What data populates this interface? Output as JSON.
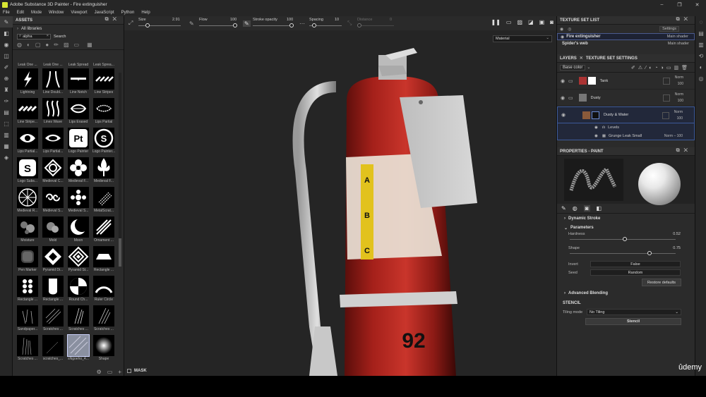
{
  "window": {
    "title": "Adobe Substance 3D Painter - Fire extinguisher",
    "min": "–",
    "max": "❐",
    "close": "✕"
  },
  "menu": [
    "File",
    "Edit",
    "Mode",
    "Window",
    "Viewport",
    "JavaScript",
    "Python",
    "Help"
  ],
  "assets": {
    "title": "ASSETS",
    "library": "All libraries",
    "search_value": "alpha",
    "search_button": "Search",
    "top_labels": [
      "Leak One ...",
      "Leak One ...",
      "Leak Spread",
      "Leak Sprea..."
    ],
    "tiles": [
      {
        "label": "Lightning",
        "icon": "lightning"
      },
      {
        "label": "Line Doubl...",
        "icon": "line-double"
      },
      {
        "label": "Line Notch",
        "icon": "line-notch"
      },
      {
        "label": "Line Stripes",
        "icon": "stripes"
      },
      {
        "label": "Line Stripe...",
        "icon": "stripes2"
      },
      {
        "label": "Lines Wave",
        "icon": "wave"
      },
      {
        "label": "Lips Erased",
        "icon": "lips"
      },
      {
        "label": "Lips Partial",
        "icon": "lips2"
      },
      {
        "label": "Lips Partial...",
        "icon": "eye"
      },
      {
        "label": "Lips Partial...",
        "icon": "eye2"
      },
      {
        "label": "Logo Painter",
        "icon": "pt"
      },
      {
        "label": "Logo Painter...",
        "icon": "s-logo"
      },
      {
        "label": "Logo Subs...",
        "icon": "s-square"
      },
      {
        "label": "Medieval C...",
        "icon": "knot"
      },
      {
        "label": "Medieval F...",
        "icon": "flower"
      },
      {
        "label": "Medieval F...",
        "icon": "fleur"
      },
      {
        "label": "Medieval R...",
        "icon": "rose"
      },
      {
        "label": "Medieval S...",
        "icon": "spiral"
      },
      {
        "label": "Medieval S...",
        "icon": "cross"
      },
      {
        "label": "MetalScrat...",
        "icon": "scratch"
      },
      {
        "label": "Moisture",
        "icon": "moisture"
      },
      {
        "label": "Mold",
        "icon": "mold"
      },
      {
        "label": "Moon",
        "icon": "moon"
      },
      {
        "label": "Ornament ...",
        "icon": "ornament"
      },
      {
        "label": "Pen Marker",
        "icon": "marker"
      },
      {
        "label": "Pyramid Di...",
        "icon": "pyramid"
      },
      {
        "label": "Pyramid St...",
        "icon": "pyramid2"
      },
      {
        "label": "Rectangle ...",
        "icon": "trap"
      },
      {
        "label": "Rectangle ...",
        "icon": "dots"
      },
      {
        "label": "Rectangle ...",
        "icon": "round"
      },
      {
        "label": "Round Ch...",
        "icon": "checker"
      },
      {
        "label": "Ruler Circle",
        "icon": "arc"
      },
      {
        "label": "Sandpaper...",
        "icon": "sand"
      },
      {
        "label": "Scratches ...",
        "icon": "scratches"
      },
      {
        "label": "Scratches ...",
        "icon": "scratches2"
      },
      {
        "label": "Scratches ...",
        "icon": "scratches3"
      },
      {
        "label": "Scratches ...",
        "icon": "scratches4"
      },
      {
        "label": "scratches_...",
        "icon": "scr5"
      },
      {
        "label": "sNgoeho_4...",
        "icon": "sel"
      },
      {
        "label": "Shape",
        "icon": "shape"
      }
    ]
  },
  "toolbar": {
    "size_label": "Size",
    "size_value": "2.91",
    "flow_label": "Flow",
    "flow_value": "100",
    "stroke_label": "Stroke opacity",
    "stroke_value": "100",
    "spacing_label": "Spacing",
    "spacing_value": "10",
    "distance_label": "Distance",
    "distance_value": "0"
  },
  "viewport": {
    "material": "Material",
    "mask": "MASK",
    "tank_letters": [
      "A",
      "B",
      "C"
    ],
    "tank_number": "92"
  },
  "texture_set_list": {
    "title": "TEXTURE SET LIST",
    "settings": "Settings",
    "rows": [
      {
        "name": "Fire extinguisher",
        "shader": "Main shader"
      },
      {
        "name": "Spider's web",
        "shader": "Main shader"
      }
    ]
  },
  "layers": {
    "tab1": "LAYERS",
    "tab2": "TEXTURE SET SETTINGS",
    "channel": "Base color",
    "rows": [
      {
        "name": "Tank",
        "blend": "Norm",
        "opacity": "100"
      },
      {
        "name": "Dusty",
        "blend": "Norm",
        "opacity": "100"
      },
      {
        "name": "Dusty & Water",
        "blend": "Norm",
        "opacity": "100"
      }
    ],
    "sub": [
      {
        "name": "Levels"
      },
      {
        "name": "Grunge Leak Small",
        "blend": "Norm",
        "opacity": "100"
      }
    ]
  },
  "properties": {
    "title": "PROPERTIES - PAINT",
    "dynamic_stroke": "Dynamic Stroke",
    "parameters": "Parameters",
    "hardness_label": "Hardness",
    "hardness_value": "0.52",
    "hardness": 0.52,
    "shape_label": "Shape",
    "shape_value": "0.75",
    "shape": 0.75,
    "invert_label": "Invert",
    "invert_value": "False",
    "seed_label": "Seed",
    "seed_value": "Random",
    "restore": "Restore defaults",
    "advanced": "Advanced Blending",
    "stencil_title": "STENCIL",
    "tiling_label": "Tiling mode",
    "tiling_value": "No Tiling",
    "stencil_button": "Stencil"
  },
  "watermark": "ûdemy",
  "colors": {
    "tank_red": "#b3241e",
    "accent": "#3d5a9a",
    "ui_bg": "#2b2b2b"
  }
}
